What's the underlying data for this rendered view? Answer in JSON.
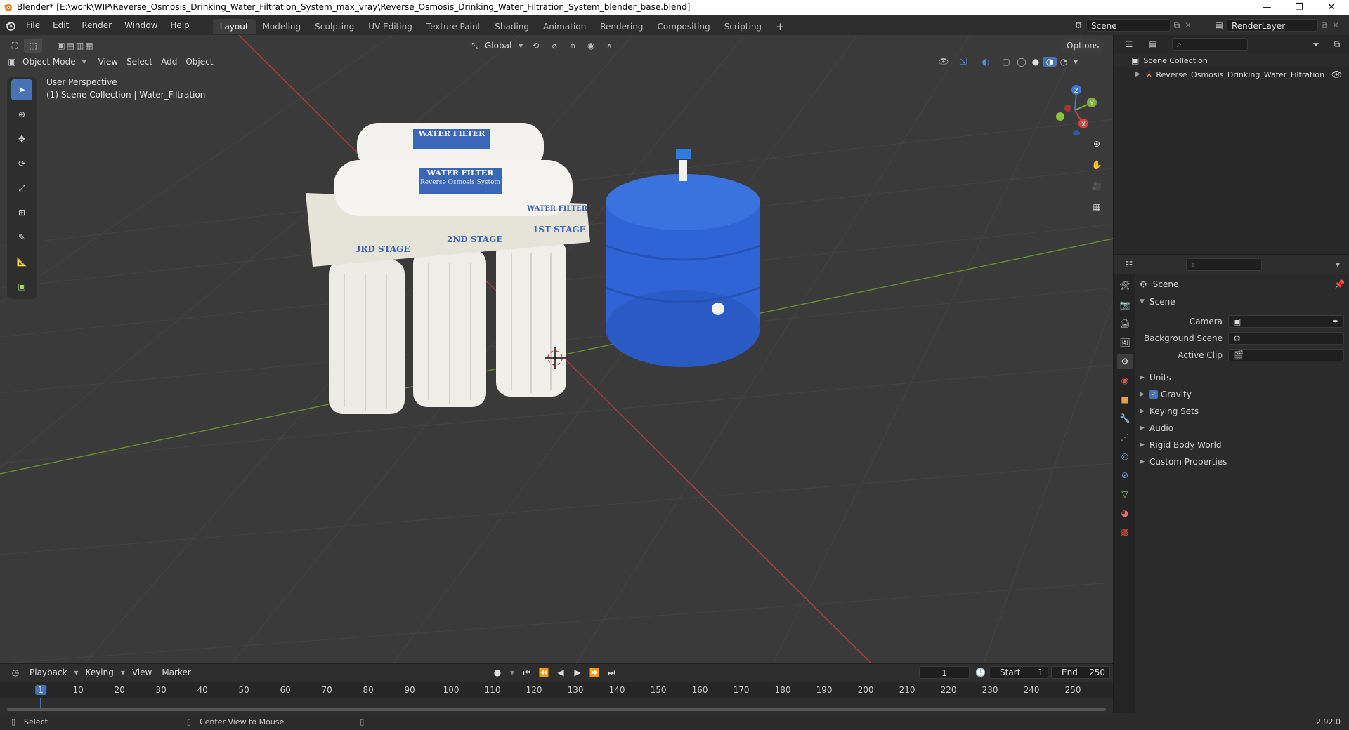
{
  "window": {
    "title": "Blender* [E:\\work\\WIP\\Reverse_Osmosis_Drinking_Water_Filtration_System_max_vray\\Reverse_Osmosis_Drinking_Water_Filtration_System_blender_base.blend]",
    "minimize": "—",
    "maximize": "❐",
    "close": "✕"
  },
  "menu": {
    "file": "File",
    "edit": "Edit",
    "render": "Render",
    "window": "Window",
    "help": "Help"
  },
  "workspaces": [
    "Layout",
    "Modeling",
    "Sculpting",
    "UV Editing",
    "Texture Paint",
    "Shading",
    "Animation",
    "Rendering",
    "Compositing",
    "Scripting"
  ],
  "add_workspace": "+",
  "scene_selector": "Scene",
  "renderlayer_selector": "RenderLayer",
  "viewport_header": {
    "mode": "Object Mode",
    "view": "View",
    "select": "Select",
    "add": "Add",
    "object": "Object",
    "transform_orientation": "Global",
    "options": "Options"
  },
  "viewport_overlay": {
    "perspective": "User Perspective",
    "collection_info": "(1) Scene Collection | Water_Filtration"
  },
  "gizmo": {
    "x": "X",
    "y": "Y",
    "z": "Z"
  },
  "model_labels": {
    "water_filter": "WATER FILTER",
    "ro_system": "Reverse Osmosis System",
    "stage3": "3RD STAGE",
    "stage2": "2ND STAGE",
    "stage1": "1ST STAGE"
  },
  "outliner": {
    "root": "Scene Collection",
    "items": [
      {
        "label": "Reverse_Osmosis_Drinking_Water_Filtration"
      }
    ]
  },
  "properties": {
    "context": "Scene",
    "panel_title": "Scene",
    "rows": [
      {
        "label": "Camera",
        "value": ""
      },
      {
        "label": "Background Scene",
        "value": ""
      },
      {
        "label": "Active Clip",
        "value": ""
      }
    ],
    "sections": [
      {
        "label": "Units",
        "checkbox": false
      },
      {
        "label": "Gravity",
        "checkbox": true
      },
      {
        "label": "Keying Sets",
        "checkbox": false
      },
      {
        "label": "Audio",
        "checkbox": false
      },
      {
        "label": "Rigid Body World",
        "checkbox": false
      },
      {
        "label": "Custom Properties",
        "checkbox": false
      }
    ]
  },
  "timeline": {
    "playback": "Playback",
    "keying": "Keying",
    "view": "View",
    "marker": "Marker",
    "current_frame": "1",
    "start_label": "Start",
    "start": "1",
    "end_label": "End",
    "end": "250",
    "ticks": [
      "1",
      "10",
      "20",
      "30",
      "40",
      "50",
      "60",
      "70",
      "80",
      "90",
      "100",
      "110",
      "120",
      "130",
      "140",
      "150",
      "160",
      "170",
      "180",
      "190",
      "200",
      "210",
      "220",
      "230",
      "240",
      "250"
    ]
  },
  "statusbar": {
    "select": "Select",
    "center_view": "Center View to Mouse",
    "version": "2.92.0"
  },
  "colors": {
    "accent": "#4772b3",
    "tank_blue": "#2f63d6",
    "x_axis": "#d44040",
    "y_axis": "#7fae3a",
    "z_axis": "#3b7ad6"
  }
}
